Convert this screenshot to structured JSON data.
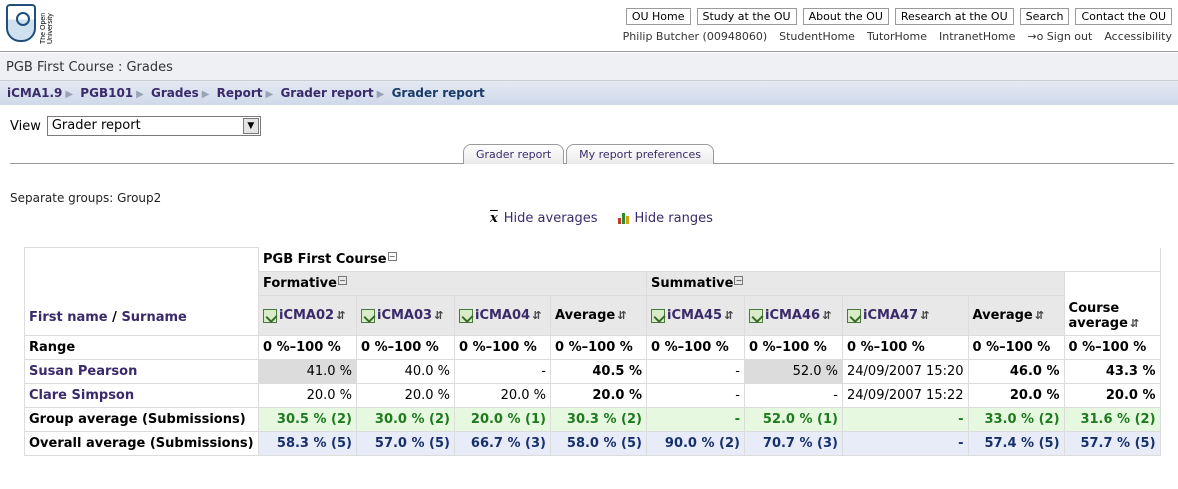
{
  "header": {
    "logo_text": "The Open University",
    "topnav": [
      "OU Home",
      "Study at the OU",
      "About the OU",
      "Research at the OU",
      "Search",
      "Contact the OU"
    ],
    "user_name": "Philip Butcher (00948060)",
    "user_links": [
      "StudentHome",
      "TutorHome",
      "IntranetHome",
      "→o Sign out",
      "Accessibility"
    ]
  },
  "page_title": "PGB First Course : Grades",
  "breadcrumb": [
    "iCMA1.9",
    "PGB101",
    "Grades",
    "Report",
    "Grader report",
    "Grader report"
  ],
  "view": {
    "label": "View",
    "selected": "Grader report"
  },
  "tabs": [
    "Grader report",
    "My report preferences"
  ],
  "groups_text": "Separate groups: Group2",
  "toggles": {
    "averages": "Hide averages",
    "ranges": "Hide ranges"
  },
  "table": {
    "course": "PGB First Course",
    "categories": {
      "formative": "Formative",
      "summative": "Summative"
    },
    "name_first": "First name",
    "name_sep": "/",
    "name_last": "Surname",
    "items": [
      "iCMA02",
      "iCMA03",
      "iCMA04",
      "iCMA45",
      "iCMA46",
      "iCMA47"
    ],
    "average_label": "Average",
    "course_avg_1": "Course",
    "course_avg_2": "average",
    "rows": {
      "range": {
        "label": "Range",
        "cells": [
          "0 %–100 %",
          "0 %–100 %",
          "0 %–100 %",
          "0 %–100 %",
          "0 %–100 %",
          "0 %–100 %",
          "0 %–100 %",
          "0 %–100 %",
          "0 %–100 %"
        ]
      },
      "students": [
        {
          "name": "Susan Pearson",
          "cells": [
            "41.0 %",
            "40.0 %",
            "-",
            "40.5 %",
            "-",
            "52.0 %",
            "24/09/2007 15:20",
            "46.0 %",
            "43.3 %"
          ]
        },
        {
          "name": "Clare Simpson",
          "cells": [
            "20.0 %",
            "20.0 %",
            "20.0 %",
            "20.0 %",
            "-",
            "-",
            "24/09/2007 15:22",
            "20.0 %",
            "20.0 %"
          ]
        }
      ],
      "group_avg": {
        "label": "Group average (Submissions)",
        "cells": [
          "30.5 % (2)",
          "30.0 % (2)",
          "20.0 % (1)",
          "30.3 % (2)",
          "-",
          "52.0 % (1)",
          "-",
          "33.0 % (2)",
          "31.6 % (2)"
        ]
      },
      "overall_avg": {
        "label": "Overall average (Submissions)",
        "cells": [
          "58.3 % (5)",
          "57.0 % (5)",
          "66.7 % (3)",
          "58.0 % (5)",
          "90.0 % (2)",
          "70.7 % (3)",
          "-",
          "57.4 % (5)",
          "57.7 % (5)"
        ]
      }
    }
  },
  "colors": {
    "link": "#3a2a6a",
    "group_avg_bg": "#e6f9e0",
    "overall_avg_bg": "#e8ebf8"
  }
}
